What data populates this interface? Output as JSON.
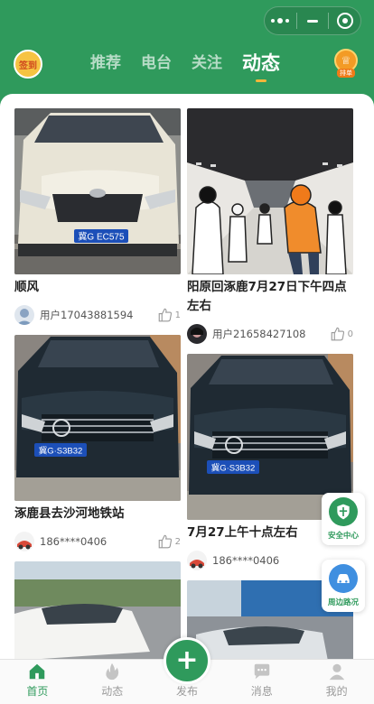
{
  "header": {
    "signin_icon_text": "签到",
    "tabs": [
      {
        "label": "推荐",
        "active": false
      },
      {
        "label": "电台",
        "active": false
      },
      {
        "label": "关注",
        "active": false
      },
      {
        "label": "动态",
        "active": true
      }
    ],
    "rank_icon_text": "排单",
    "accent_color": "#2f9a5c",
    "indicator_color": "#f3b63a"
  },
  "feed": {
    "left": [
      {
        "title": "顺风",
        "plate": "冀G EC575",
        "user": "用户17043881594",
        "likes": "1"
      },
      {
        "title": "涿鹿县去沙河地铁站",
        "plate": "冀G·S3B32",
        "user": "186****0406",
        "likes": "2"
      },
      {
        "title": "",
        "plate": "",
        "user": "",
        "likes": ""
      }
    ],
    "right": [
      {
        "title": "阳原回涿鹿7月27日下午四点左右",
        "plate": "",
        "user": "用户21658427108",
        "likes": "0"
      },
      {
        "title": "7月27上午十点左右",
        "plate": "冀G·S3B32",
        "user": "186****0406",
        "likes": ""
      },
      {
        "title": "",
        "plate": "",
        "user": "",
        "likes": ""
      }
    ]
  },
  "floating": {
    "safety_label": "安全中心",
    "nearby_label": "周边路况"
  },
  "bottom_nav": {
    "items": [
      {
        "label": "首页",
        "icon": "home-icon",
        "active": true
      },
      {
        "label": "动态",
        "icon": "fire-icon",
        "active": false
      },
      {
        "label": "发布",
        "icon": "plus-icon",
        "active": false
      },
      {
        "label": "消息",
        "icon": "chat-icon",
        "active": false
      },
      {
        "label": "我的",
        "icon": "user-icon",
        "active": false
      }
    ],
    "publish_symbol": "+"
  }
}
